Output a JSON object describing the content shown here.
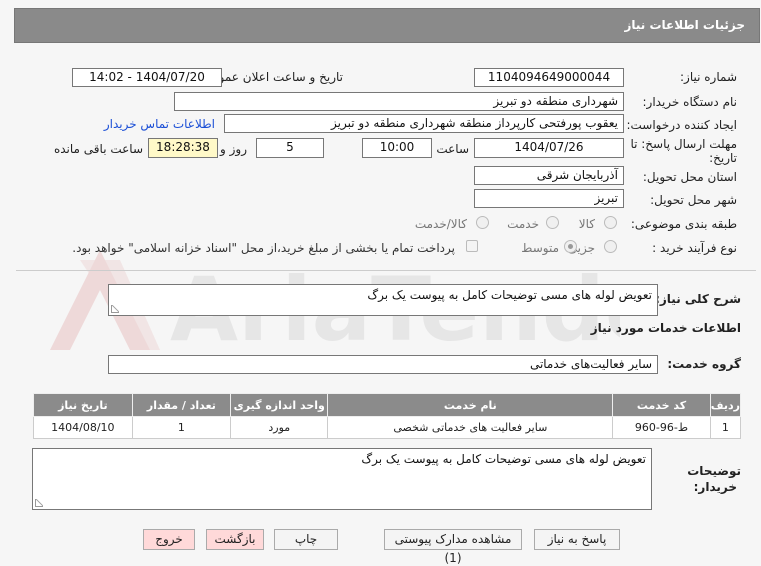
{
  "header": {
    "title": "جزئیات اطلاعات نیاز"
  },
  "fields": {
    "need_number_label": "شماره نیاز:",
    "need_number": "1104094649000044",
    "announce_label": "تاریخ و ساعت اعلان عمومی:",
    "announce_value": "1404/07/20 - 14:02",
    "buyer_org_label": "نام دستگاه خریدار:",
    "buyer_org": "شهرداری منطقه دو تبریز",
    "creator_label": "ایجاد کننده درخواست:",
    "creator": "یعقوب پورفتحی کارپرداز منطقه شهرداری منطقه دو تبریز",
    "contact_link": "اطلاعات تماس خریدار",
    "deadline_label": "مهلت ارسال پاسخ: تا",
    "deadline_label2": "تاریخ:",
    "deadline_date": "1404/07/26",
    "time_label": "ساعت",
    "deadline_time": "10:00",
    "days_value": "5",
    "days_label": "روز و",
    "remaining_time": "18:28:38",
    "remaining_label": "ساعت باقی مانده",
    "province_label": "استان محل تحویل:",
    "province": "آذربایجان شرقی",
    "city_label": "شهر محل تحویل:",
    "city": "تبریز",
    "category_label": "طبقه بندی موضوعی:",
    "cat_goods": "کالا",
    "cat_service": "خدمت",
    "cat_goods_service": "کالا/خدمت",
    "purchase_type_label": "نوع فرآیند خرید :",
    "pt_partial": "جزیی",
    "pt_medium": "متوسط",
    "payment_note": "پرداخت تمام یا بخشی از مبلغ خرید،از محل \"اسناد خزانه اسلامی\" خواهد بود."
  },
  "summary": {
    "label": "شرح کلی نیاز:",
    "value": "تعویض لوله های مسی توضیحات کامل به پیوست یک برگ"
  },
  "services_info": {
    "title": "اطلاعات خدمات مورد نیاز"
  },
  "service_group": {
    "label": "گروه خدمت:",
    "value": "سایر فعالیت‌های خدماتی"
  },
  "table": {
    "headers": [
      "ردیف",
      "کد خدمت",
      "نام خدمت",
      "واحد اندازه گیری",
      "تعداد / مقدار",
      "تاریخ نیاز"
    ],
    "rows": [
      [
        "1",
        "ط-96-960",
        "سایر فعالیت های خدماتی شخصی",
        "مورد",
        "1",
        "1404/08/10"
      ]
    ]
  },
  "buyer_notes": {
    "label1": "توضیحات",
    "label2": "خریدار:",
    "value": "تعویض لوله های مسی توضیحات کامل به پیوست یک برگ"
  },
  "buttons": {
    "reply": "پاسخ به نیاز",
    "view_docs": "مشاهده مدارک پیوستی (1)",
    "print": "چاپ",
    "back": "بازگشت",
    "exit": "خروج"
  },
  "watermark": {
    "text": "AriaTender.net"
  }
}
